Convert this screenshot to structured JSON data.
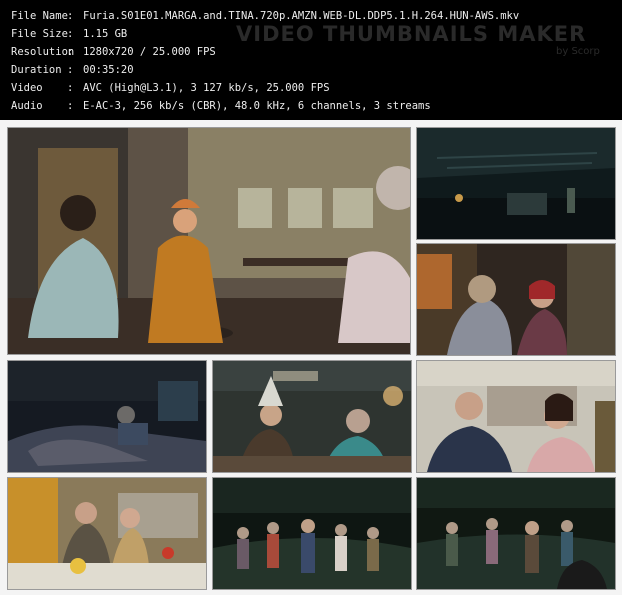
{
  "info": [
    {
      "key": "File Name",
      "value": "Furia.S01E01.MARGA.and.TINA.720p.AMZN.WEB-DL.DDP5.1.H.264.HUN-AWS.mkv"
    },
    {
      "key": "File Size",
      "value": "1.15 GB"
    },
    {
      "key": "Resolution",
      "value": "1280x720 / 25.000 FPS"
    },
    {
      "key": "Duration",
      "value": "00:35:20"
    },
    {
      "key": "Video",
      "value": "AVC (High@L3.1), 3 127 kb/s, 25.000 FPS"
    },
    {
      "key": "Audio",
      "value": "E-AC-3, 256 kb/s (CBR), 48.0 kHz, 6 channels, 3 streams"
    }
  ],
  "separator": ":",
  "watermark": {
    "title": "VIDEO THUMBNAILS MAKER",
    "sub": "by Scorp"
  }
}
